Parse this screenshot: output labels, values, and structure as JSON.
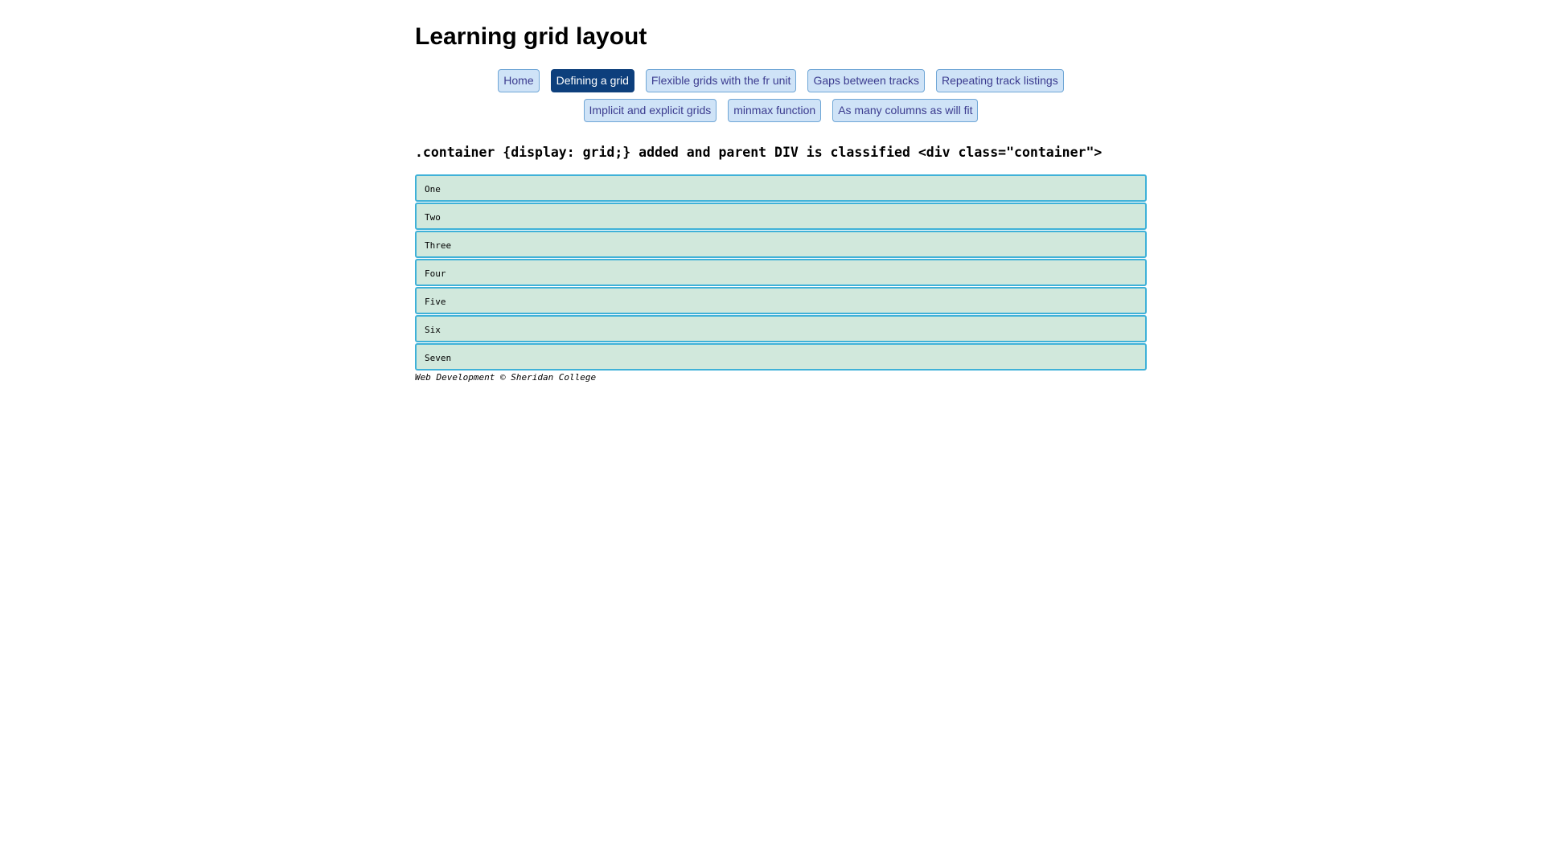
{
  "header": {
    "title": "Learning grid layout"
  },
  "nav": {
    "row1": [
      {
        "label": "Home",
        "active": false
      },
      {
        "label": "Defining a grid",
        "active": true
      },
      {
        "label": "Flexible grids with the fr unit",
        "active": false
      },
      {
        "label": "Gaps between tracks",
        "active": false
      },
      {
        "label": "Repeating track listings",
        "active": false
      }
    ],
    "row2": [
      {
        "label": "Implicit and explicit grids",
        "active": false
      },
      {
        "label": "minmax function",
        "active": false
      },
      {
        "label": "As many columns as will fit",
        "active": false
      }
    ]
  },
  "main": {
    "code_heading": ".container {display: grid;} added and parent DIV is classified <div class=\"container\">",
    "items": [
      "One",
      "Two",
      "Three",
      "Four",
      "Five",
      "Six",
      "Seven"
    ]
  },
  "footer": {
    "text": "Web Development © Sheridan College"
  },
  "colors": {
    "nav_bg": "#cfe3f7",
    "nav_active_bg": "#0d3f7c",
    "item_bg": "#d1e8dc",
    "item_border": "#3fb1d8"
  }
}
